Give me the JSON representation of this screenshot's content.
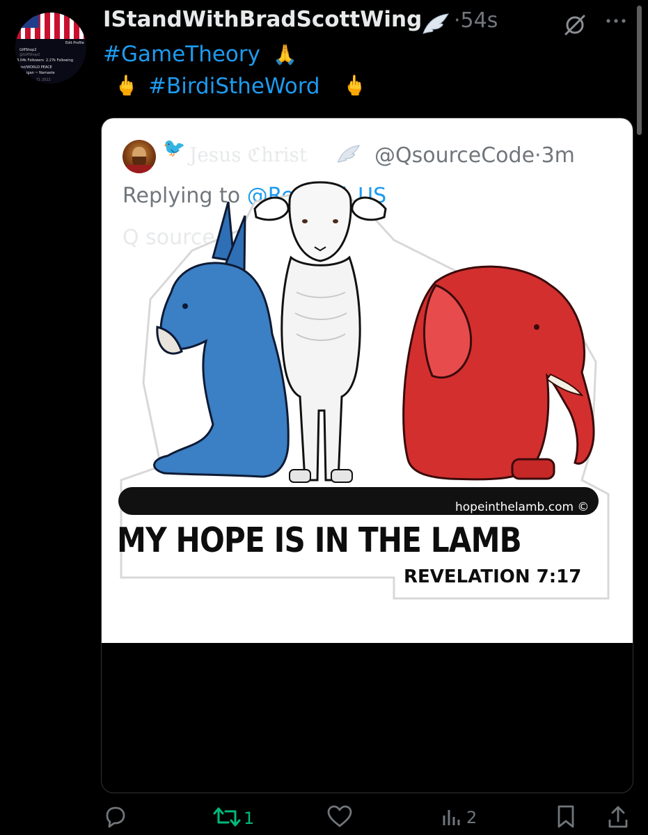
{
  "post": {
    "display_name": "IStandWithBradScottWing",
    "name_emoji": "🪽",
    "timestamp": "·54s",
    "line1_tag": "#GameTheory",
    "line1_emoji": "🙏",
    "line2_emoji": "🖕",
    "line2_tag": "#BirdiStheWord",
    "avatar_text": {
      "name": "GiffShop2",
      "handle": "@GiffShop2",
      "edit": "Edit Profile",
      "followers": "3.04k Followers",
      "following": "2.27k Following",
      "bio": "triot/WORLD PEACE",
      "bio2": "igan ~ Namaste",
      "date": "71 2022"
    }
  },
  "quote": {
    "bird_emoji": "🐦",
    "name": "Jesus ℭhrist",
    "name_emoji": "🪽",
    "handle_time": "@QsourceCode·3m",
    "replying_prefix": "Replying to",
    "replying_mention": "@Red_Pill_US",
    "text": "Q source",
    "image": {
      "site": "hopeinthelamb.com ©",
      "headline": "MY HOPE IS IN THE LAMB",
      "verse": "REVELATION 7:17"
    }
  },
  "actions": {
    "reply_count": "",
    "retweet_count": "1",
    "like_count": "",
    "views_count": "2"
  },
  "colors": {
    "background": "#000000",
    "link": "#1d9bf0",
    "retweet": "#00ba7c",
    "muted": "#71767b"
  },
  "icons": [
    "reply-icon",
    "retweet-icon",
    "like-icon",
    "views-icon",
    "bookmark-icon",
    "share-icon",
    "grok-icon",
    "more-icon"
  ]
}
